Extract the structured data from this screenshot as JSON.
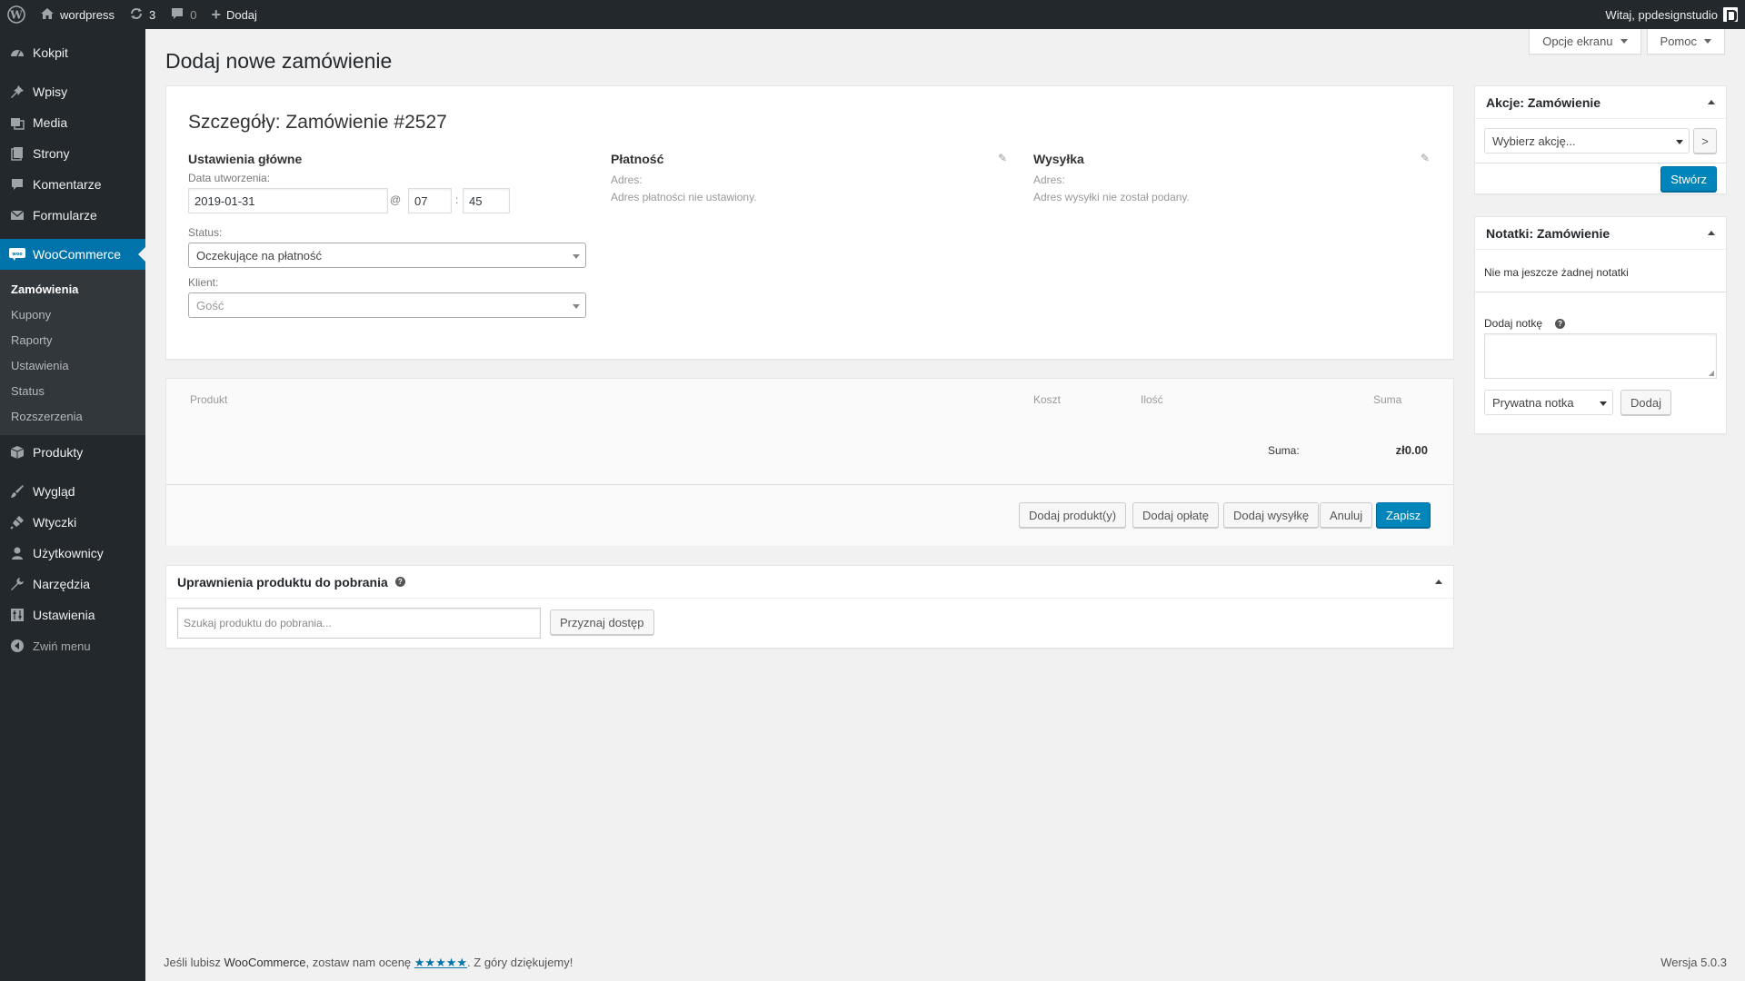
{
  "adminbar": {
    "site_name": "wordpress",
    "updates_count": "3",
    "comments_count": "0",
    "new_label": "Dodaj",
    "greeting": "Witaj, ppdesignstudio"
  },
  "sidebar": {
    "items": [
      {
        "label": "Kokpit",
        "icon": "dashboard-icon"
      },
      {
        "label": "Wpisy",
        "icon": "pin-icon"
      },
      {
        "label": "Media",
        "icon": "media-icon"
      },
      {
        "label": "Strony",
        "icon": "pages-icon"
      },
      {
        "label": "Komentarze",
        "icon": "comments-icon"
      },
      {
        "label": "Formularze",
        "icon": "mail-icon"
      },
      {
        "label": "WooCommerce",
        "icon": "woo-icon"
      },
      {
        "label": "Produkty",
        "icon": "product-icon"
      },
      {
        "label": "Wygląd",
        "icon": "brush-icon"
      },
      {
        "label": "Wtyczki",
        "icon": "plugin-icon"
      },
      {
        "label": "Użytkownicy",
        "icon": "users-icon"
      },
      {
        "label": "Narzędzia",
        "icon": "wrench-icon"
      },
      {
        "label": "Ustawienia",
        "icon": "settings-icon"
      }
    ],
    "woo_submenu": [
      "Zamówienia",
      "Kupony",
      "Raporty",
      "Ustawienia",
      "Status",
      "Rozszerzenia"
    ],
    "collapse_label": "Zwiń menu"
  },
  "top_tabs": {
    "screen_options": "Opcje ekranu",
    "help": "Pomoc"
  },
  "page_title": "Dodaj nowe zamówienie",
  "order": {
    "heading": "Szczegóły: Zamówienie #2527",
    "general": {
      "title": "Ustawienia główne",
      "date_label": "Data utworzenia:",
      "date_value": "2019-01-31",
      "at": "@",
      "hour": "07",
      "colon": ":",
      "minute": "45",
      "status_label": "Status:",
      "status_value": "Oczekujące na płatność",
      "customer_label": "Klient:",
      "customer_value": "Gość"
    },
    "billing": {
      "title": "Płatność",
      "address_label": "Adres:",
      "address_value": "Adres płatności nie ustawiony."
    },
    "shipping": {
      "title": "Wysyłka",
      "address_label": "Adres:",
      "address_value": "Adres wysyłki nie został podany."
    }
  },
  "items": {
    "col_product": "Produkt",
    "col_cost": "Koszt",
    "col_qty": "Ilość",
    "col_total": "Suma",
    "total_label": "Suma:",
    "total_value": "zł0.00",
    "buttons": {
      "add_product": "Dodaj produkt(y)",
      "add_fee": "Dodaj opłatę",
      "add_shipping": "Dodaj wysyłkę",
      "cancel": "Anuluj",
      "save": "Zapisz"
    }
  },
  "downloads": {
    "title": "Uprawnienia produktu do pobrania",
    "search_placeholder": "Szukaj produktu do pobrania...",
    "grant_button": "Przyznaj dostęp"
  },
  "actions_box": {
    "title": "Akcje: Zamówienie",
    "select_value": "Wybierz akcję...",
    "go_label": ">",
    "create_button": "Stwórz"
  },
  "notes_box": {
    "title": "Notatki: Zamówienie",
    "empty_text": "Nie ma jeszcze żadnej notatki",
    "add_label": "Dodaj notkę",
    "note_type": "Prywatna notka",
    "add_button": "Dodaj"
  },
  "footer": {
    "text_before": "Jeśli lubisz ",
    "brand": "WooCommerce",
    "text_mid": ", zostaw nam ocenę ",
    "stars": "★★★★★",
    "text_after": ". Z góry dziękujemy!",
    "version": "Wersja 5.0.3"
  },
  "colors": {
    "adminbar_bg": "#23282d",
    "accent": "#0073aa",
    "primary_button": "#0085ba",
    "page_bg": "#f1f1f1"
  }
}
